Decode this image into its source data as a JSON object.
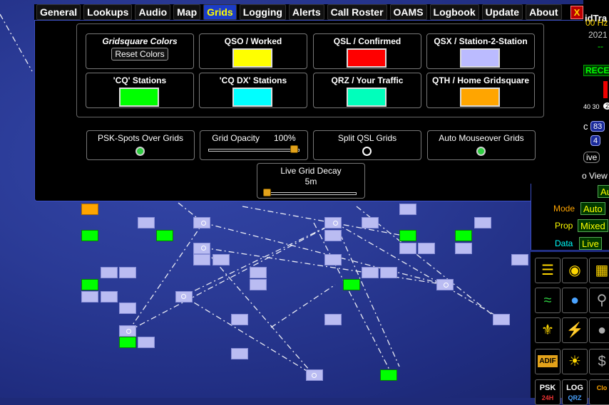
{
  "tabs": [
    {
      "label": "General"
    },
    {
      "label": "Lookups"
    },
    {
      "label": "Audio"
    },
    {
      "label": "Map"
    },
    {
      "label": "Grids",
      "active": true
    },
    {
      "label": "Logging"
    },
    {
      "label": "Alerts"
    },
    {
      "label": "Call Roster"
    },
    {
      "label": "OAMS"
    },
    {
      "label": "Logbook"
    },
    {
      "label": "Update"
    },
    {
      "label": "About"
    }
  ],
  "close_label": "X",
  "grids": {
    "colors_title": "Gridsquare Colors",
    "reset_label": "Reset Colors",
    "categories": [
      {
        "label": "QSO / Worked",
        "color": "#ffff00"
      },
      {
        "label": "QSL / Confirmed",
        "color": "#ff0000"
      },
      {
        "label": "QSX / Station-2-Station",
        "color": "#bbbbff"
      },
      {
        "label": "'CQ' Stations",
        "color": "#00ff00"
      },
      {
        "label": "'CQ DX' Stations",
        "color": "#00ffff"
      },
      {
        "label": "QRZ / Your Traffic",
        "color": "#00ffbb"
      },
      {
        "label": "QTH / Home Gridsquare",
        "color": "#ffa500"
      }
    ],
    "psk_spots": {
      "label": "PSK-Spots Over Grids",
      "enabled": true
    },
    "opacity": {
      "label": "Grid Opacity",
      "value": "100%",
      "fraction": 1.0
    },
    "split_qsl": {
      "label": "Split QSL Grids",
      "enabled": false
    },
    "auto_mouseover": {
      "label": "Auto Mouseover Grids",
      "enabled": true
    },
    "decay": {
      "label": "Live Grid Decay",
      "value": "5m",
      "fraction": 0.0
    }
  },
  "side": {
    "title_partial": "idTra",
    "hz_partial": "00 Hz",
    "year_partial": "2021",
    "dashes": "--",
    "recent_partial": "RECEI",
    "numbers_partial": "40 30",
    "circle_partial": "2",
    "c_partial": "c",
    "badge_a": "83",
    "badge_b": "4",
    "ive_partial": "ive",
    "view_partial": "o View",
    "au_partial": "Au",
    "mode_label": "Mode",
    "mode_value": "Auto",
    "prop_label": "Prop",
    "prop_value": "Mixed",
    "data_label": "Data",
    "data_value": "Live",
    "adif_label": "ADIF",
    "psk_label": "PSK",
    "log_partial": "LOG",
    "bottom_partial_1": "24H",
    "bottom_partial_2": "QRZ",
    "bottom_partial_3": "Clo"
  }
}
